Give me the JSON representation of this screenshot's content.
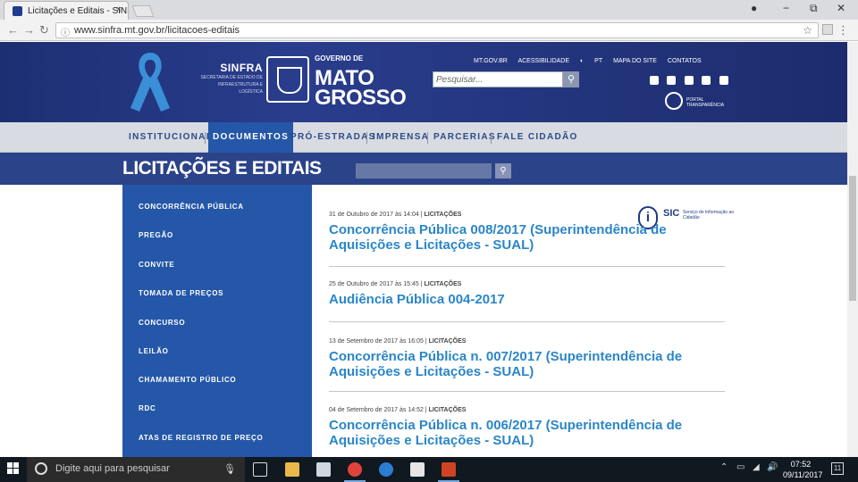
{
  "browser": {
    "tab_title": "Licitações e Editais - SINF",
    "tab_close": "×",
    "url": "www.sinfra.mt.gov.br/licitacoes-editais",
    "window_controls": [
      "−",
      "⧉",
      "✕"
    ]
  },
  "header": {
    "sinfra": "SINFRA",
    "sinfra_sub": "SECRETARIA DE ESTADO DE INFRAESTRUTURA E LOGÍSTICA",
    "gov_small": "GOVERNO DE",
    "gov_line1": "MATO",
    "gov_line2": "GROSSO",
    "top_links": [
      "MT.GOV.BR",
      "ACESSIBILIDADE",
      "◐",
      "PT",
      "MAPA DO SITE",
      "CONTATOS"
    ],
    "search_placeholder": "Pesquisar...",
    "transparency": "PORTAL TRANSPARÊNCIA",
    "ribbon_color": "#3a8fd6"
  },
  "nav": {
    "items": [
      "INSTITUCIONAL",
      "DOCUMENTOS",
      "PRÓ-ESTRADAS",
      "IMPRENSA",
      "PARCERIAS",
      "FALE CIDADÃO"
    ],
    "active": "DOCUMENTOS",
    "sic_title": "SIC",
    "sic_sub": "Serviço de Informação ao Cidadão"
  },
  "page_title": "LICITAÇÕES E EDITAIS",
  "sidebar": {
    "items": [
      "CONCORRÊNCIA PÚBLICA",
      "PREGÃO",
      "CONVITE",
      "TOMADA DE PREÇOS",
      "CONCURSO",
      "LEILÃO",
      "CHAMAMENTO PÚBLICO",
      "RDC",
      "ATAS DE REGISTRO DE PREÇO"
    ]
  },
  "news": [
    {
      "date": "31 de Outubro de 2017 às 14:04",
      "category": "LICITAÇÕES",
      "title": "Concorrência Pública 008/2017 (Superintendência de Aquisições e Licitações - SUAL)"
    },
    {
      "date": "25 de Outubro de 2017 às 15:45",
      "category": "LICITAÇÕES",
      "title": "Audiência Pública 004-2017"
    },
    {
      "date": "13 de Setembro de 2017 às 16:05",
      "category": "LICITAÇÕES",
      "title": "Concorrência Pública n. 007/2017 (Superintendência de Aquisições e Licitações - SUAL)"
    },
    {
      "date": "04 de Setembro de 2017 às 14:52",
      "category": "LICITAÇÕES",
      "title": "Concorrência Pública n. 006/2017 (Superintendência de Aquisições e Licitações - SUAL)"
    }
  ],
  "taskbar": {
    "search_placeholder": "Digite aqui para pesquisar",
    "time": "07:52",
    "date": "09/11/2017",
    "notifications": "11"
  }
}
